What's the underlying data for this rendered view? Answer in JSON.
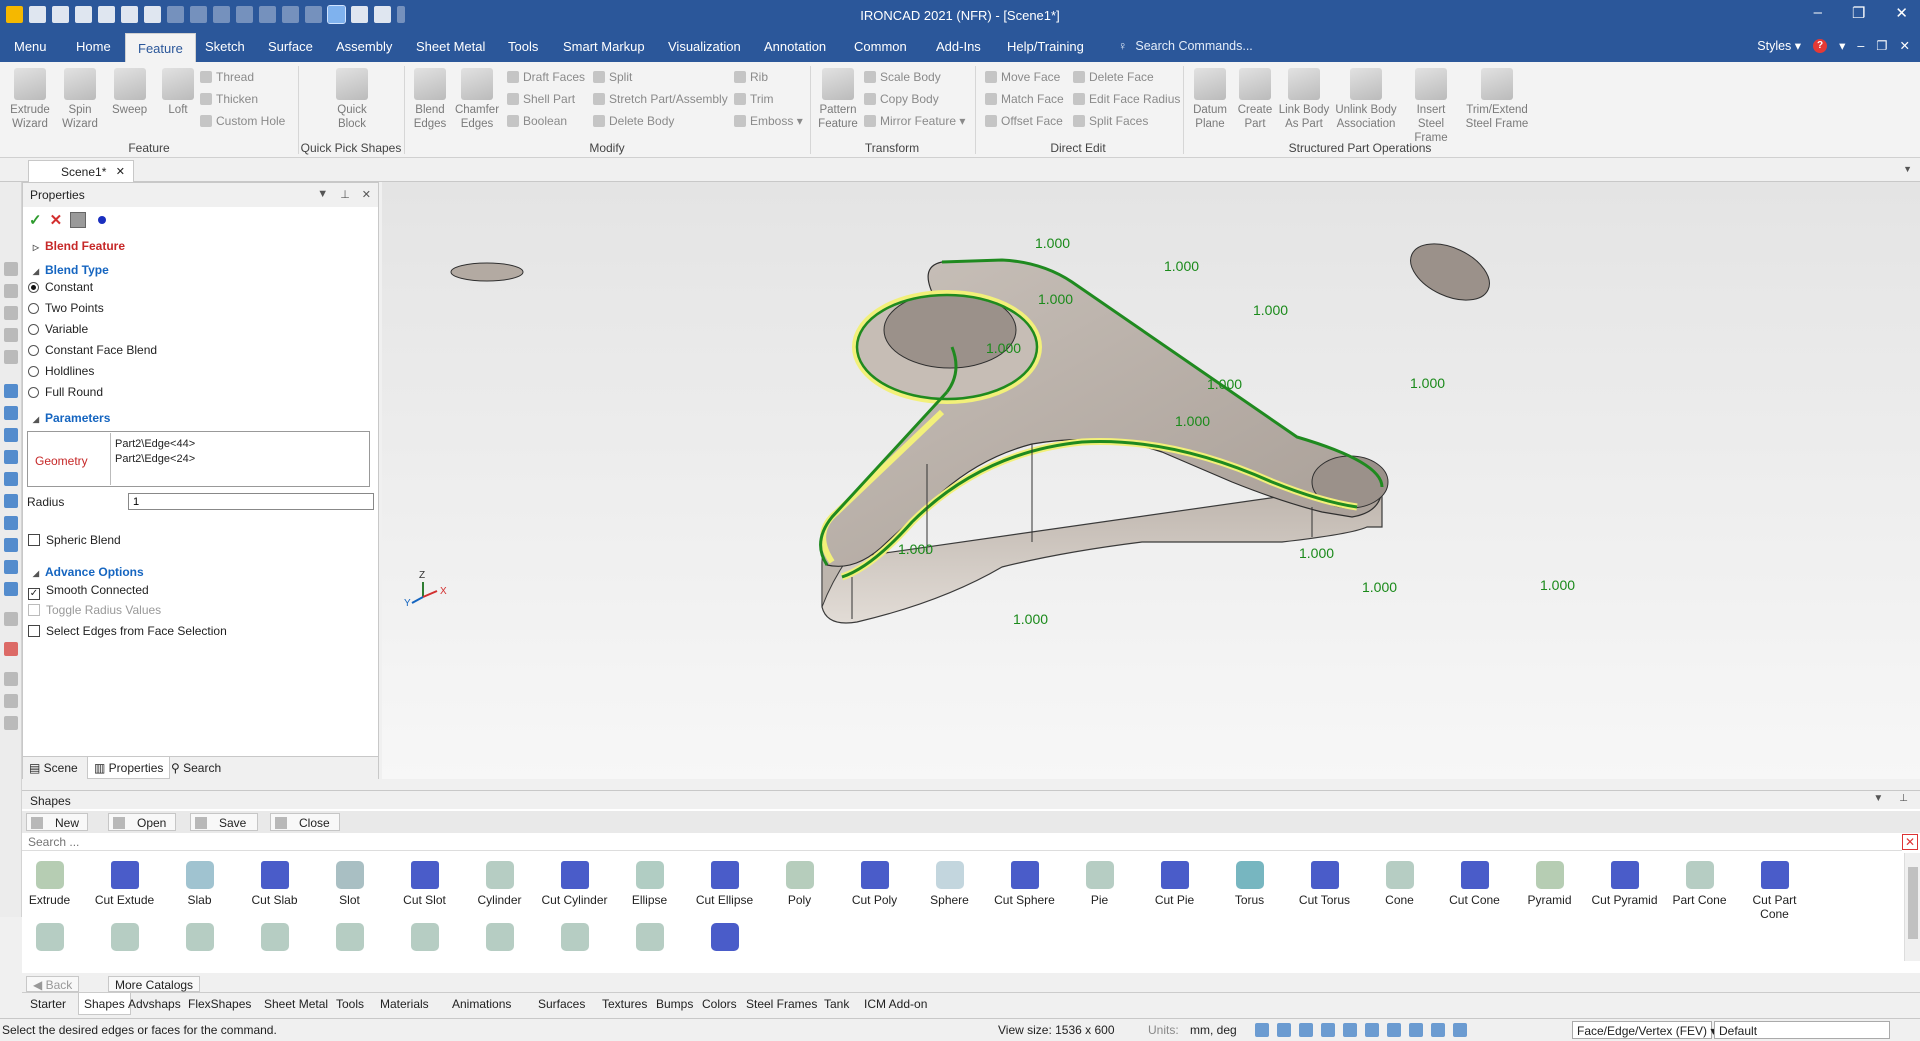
{
  "app": {
    "title": "IRONCAD 2021 (NFR) - [Scene1*]"
  },
  "menubar": {
    "tabs": [
      {
        "label": "Menu",
        "active": false
      },
      {
        "label": "Home",
        "active": false
      },
      {
        "label": "Feature",
        "active": true
      },
      {
        "label": "Sketch",
        "active": false
      },
      {
        "label": "Surface",
        "active": false
      },
      {
        "label": "Assembly",
        "active": false
      },
      {
        "label": "Sheet Metal",
        "active": false
      },
      {
        "label": "Tools",
        "active": false
      },
      {
        "label": "Smart Markup",
        "active": false
      },
      {
        "label": "Visualization",
        "active": false
      },
      {
        "label": "Annotation",
        "active": false
      },
      {
        "label": "Common",
        "active": false
      },
      {
        "label": "Add-Ins",
        "active": false
      },
      {
        "label": "Help/Training",
        "active": false
      }
    ],
    "search_placeholder": "Search Commands...",
    "styles_label": "Styles"
  },
  "ribbon": {
    "feature": {
      "label": "Feature",
      "extrude": "Extrude Wizard",
      "spin": "Spin Wizard",
      "sweep": "Sweep",
      "loft": "Loft",
      "thread": "Thread",
      "thicken": "Thicken",
      "custom_hole": "Custom Hole"
    },
    "quick_pick": {
      "label": "Quick Pick Shapes",
      "quick_block": "Quick Block"
    },
    "modify": {
      "label": "Modify",
      "blend_edges": "Blend Edges",
      "chamfer_edges": "Chamfer Edges",
      "draft_faces": "Draft Faces",
      "shell_part": "Shell Part",
      "boolean": "Boolean",
      "split": "Split",
      "stretch": "Stretch Part/Assembly",
      "delete_body": "Delete Body",
      "rib": "Rib",
      "trim": "Trim",
      "emboss": "Emboss"
    },
    "transform": {
      "label": "Transform",
      "pattern_feature": "Pattern Feature",
      "scale_body": "Scale Body",
      "copy_body": "Copy Body",
      "mirror_feature": "Mirror Feature"
    },
    "direct_edit": {
      "label": "Direct Edit",
      "move_face": "Move Face",
      "match_face": "Match Face",
      "offset_face": "Offset Face",
      "delete_face": "Delete Face",
      "edit_face_radius": "Edit Face Radius",
      "split_faces": "Split Faces"
    },
    "structured": {
      "label": "Structured Part Operations",
      "datum_plane": "Datum Plane",
      "create_part": "Create Part",
      "link_body": "Link Body As Part",
      "unlink_body": "Unlink Body Association",
      "insert_steel": "Insert Steel Frame",
      "trim_extend": "Trim/Extend Steel Frame"
    }
  },
  "doc_tab": {
    "label": "Scene1*"
  },
  "properties": {
    "title": "Properties",
    "blend_feature": "Blend Feature",
    "blend_type": "Blend Type",
    "types": [
      {
        "label": "Constant",
        "selected": true
      },
      {
        "label": "Two Points",
        "selected": false
      },
      {
        "label": "Variable",
        "selected": false
      },
      {
        "label": "Constant Face Blend",
        "selected": false
      },
      {
        "label": "Holdlines",
        "selected": false
      },
      {
        "label": "Full Round",
        "selected": false
      }
    ],
    "parameters": "Parameters",
    "geometry_label": "Geometry",
    "geometry_items": [
      "Part2\\Edge<44>",
      "Part2\\Edge<24>"
    ],
    "radius_label": "Radius",
    "radius_value": "1",
    "spheric_blend": "Spheric Blend",
    "advance_options": "Advance Options",
    "smooth_connected": "Smooth Connected",
    "toggle_radius": "Toggle Radius Values",
    "select_edges": "Select Edges from Face Selection",
    "tabs": {
      "scene": "Scene",
      "properties": "Properties",
      "search": "Search"
    }
  },
  "viewport": {
    "dimension_label": "1.000",
    "axis": {
      "x": "X",
      "y": "Y",
      "z": "Z"
    }
  },
  "shapes": {
    "title": "Shapes",
    "toolbar": {
      "new": "New",
      "open": "Open",
      "save": "Save",
      "close": "Close"
    },
    "search_placeholder": "Search ...",
    "items": [
      "Extrude",
      "Cut Extude",
      "Slab",
      "Cut Slab",
      "Slot",
      "Cut Slot",
      "Cylinder",
      "Cut Cylinder",
      "Ellipse",
      "Cut Ellipse",
      "Poly",
      "Cut Poly",
      "Sphere",
      "Cut Sphere",
      "Pie",
      "Cut Pie",
      "Torus",
      "Cut Torus",
      "Cone",
      "Cut Cone",
      "Pyramid",
      "Cut Pyramid",
      "Part Cone",
      "Cut Part Cone"
    ],
    "back": "Back",
    "more_catalogs": "More Catalogs"
  },
  "catalog_tabs": [
    {
      "label": "Starter",
      "active": false
    },
    {
      "label": "Shapes",
      "active": true
    },
    {
      "label": "Advshaps",
      "active": false
    },
    {
      "label": "FlexShapes",
      "active": false
    },
    {
      "label": "Sheet Metal",
      "active": false
    },
    {
      "label": "Tools",
      "active": false
    },
    {
      "label": "Materials",
      "active": false
    },
    {
      "label": "Animations",
      "active": false
    },
    {
      "label": "Surfaces",
      "active": false
    },
    {
      "label": "Textures",
      "active": false
    },
    {
      "label": "Bumps",
      "active": false
    },
    {
      "label": "Colors",
      "active": false
    },
    {
      "label": "Steel Frames",
      "active": false
    },
    {
      "label": "Tank",
      "active": false
    },
    {
      "label": "ICM Add-on",
      "active": false
    }
  ],
  "status": {
    "message": "Select the desired edges or faces for the command.",
    "view_size": "View size: 1536 x  600",
    "units_label": "Units:",
    "units_value": "mm, deg",
    "selection_mode": "Face/Edge/Vertex (FEV)",
    "style": "Default"
  },
  "colors": {
    "accent": "#2b579a",
    "blend_edge": "#1f8a1f",
    "highlight": "#f2f07a",
    "part": "#b5aca4"
  }
}
